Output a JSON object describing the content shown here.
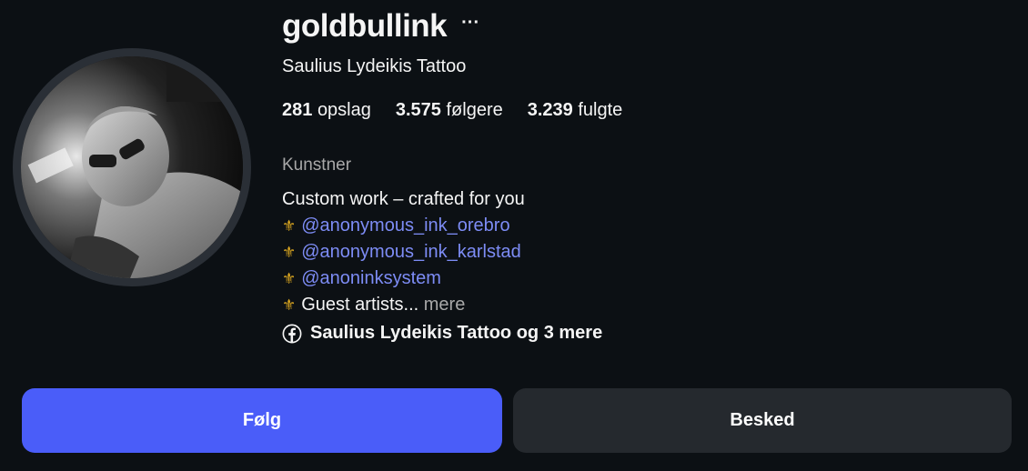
{
  "profile": {
    "username": "goldbullink",
    "more_label": "···",
    "full_name": "Saulius Lydeikis Tattoo",
    "stats": [
      {
        "count": "281",
        "label": "opslag"
      },
      {
        "count": "3.575",
        "label": "følgere"
      },
      {
        "count": "3.239",
        "label": "fulgte"
      }
    ],
    "category": "Kunstner",
    "bio": {
      "line1": "Custom work – crafted for you",
      "fleur": "⚜",
      "mention1": "@anonymous_ink_orebro",
      "mention2": "@anonymous_ink_karlstad",
      "mention3": "@anoninksystem",
      "guest_text": "Guest artists...",
      "more_label": "mere"
    },
    "linked_accounts": "Saulius Lydeikis Tattoo og 3 mere"
  },
  "actions": {
    "follow_label": "Følg",
    "message_label": "Besked"
  },
  "colors": {
    "background": "#0c1014",
    "follow_button": "#4a5df9",
    "message_button": "#25292e",
    "mention_link": "#7d8cf5",
    "secondary_text": "#a8a8a8",
    "fleur": "#d9a520"
  },
  "icons": {
    "linked": "facebook-icon",
    "options": "more-options-icon"
  }
}
